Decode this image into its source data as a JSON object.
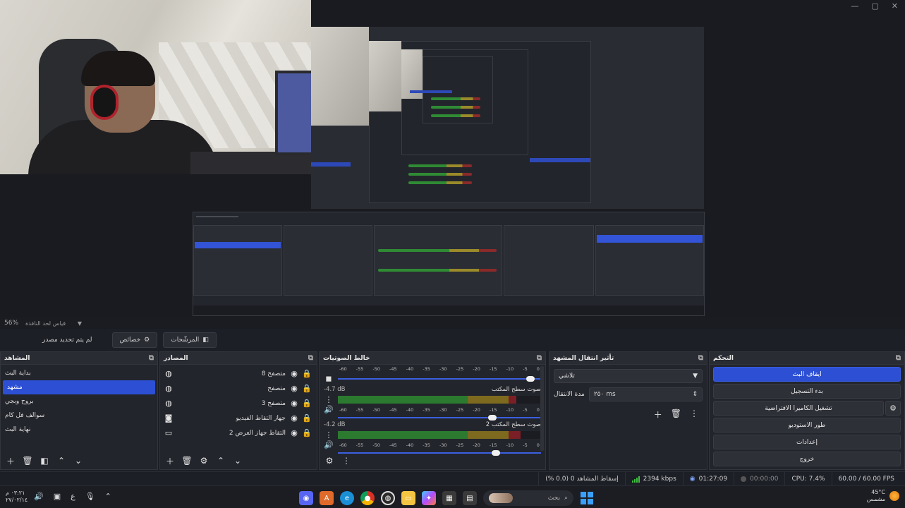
{
  "window": {
    "minimize": "—",
    "maximize": "▢",
    "close": "✕"
  },
  "zoom": {
    "percent": "56%",
    "label": "قياس لحد النافذة"
  },
  "toolbar": {
    "filters_label": "المرشّحات",
    "properties_label": "خصائص",
    "no_source_label": "لم يتم تحديد مصدر"
  },
  "scenes": {
    "title": "المشاهد",
    "items": [
      "بداية البث",
      "مشهد",
      "بروح وبجي",
      "سوالف فل كام",
      "نهاية البث"
    ],
    "active_index": 1
  },
  "sources": {
    "title": "المصادر",
    "items": [
      {
        "label": "متصفح 8",
        "icon": "globe-icon"
      },
      {
        "label": "متصفح",
        "icon": "globe-icon"
      },
      {
        "label": "متصفح 3",
        "icon": "globe-icon"
      },
      {
        "label": "جهاز التقاط الفيديو",
        "icon": "camera-icon"
      },
      {
        "label": "التقاط جهاز العرض 2",
        "icon": "monitor-icon"
      }
    ]
  },
  "mixer": {
    "title": "خالط الصوتيات",
    "ticks": [
      "-60",
      "-55",
      "-50",
      "-45",
      "-40",
      "-35",
      "-30",
      "-25",
      "-20",
      "-15",
      "-10",
      "-5",
      "0"
    ],
    "strips": [
      {
        "name": "",
        "db": "",
        "level": 0.0,
        "volume": 0.97
      },
      {
        "name": "صوت سطح المكتب",
        "db": "-4.7 dB",
        "level": 0.88,
        "volume": 0.78
      },
      {
        "name": "صوت سطح المكتب 2",
        "db": "-4.2 dB",
        "level": 0.9,
        "volume": 0.8
      }
    ]
  },
  "transitions": {
    "title": "تأثير انتقال المشهد",
    "type": "تلاشي",
    "duration_label": "مدة الانتقال",
    "duration_value": "٢٥٠ ms"
  },
  "controls": {
    "title": "التحكم",
    "stop_stream": "ايقاف البث",
    "start_recording": "بدء التسجيل",
    "virtual_camera": "تشغيل الكاميرا الافتراضية",
    "studio_mode": "طور الاستوديو",
    "settings": "إعدادات",
    "exit": "خروج"
  },
  "status": {
    "dropped": "إسقاط المشاهد 0 (0.0 %)",
    "bitrate": "2394 kbps",
    "stream_time": "01:27:09",
    "rec_time": "00:00:00",
    "cpu": "CPU: 7.4%",
    "fps": "60.00 / 60.00 FPS"
  },
  "taskbar": {
    "time": "٠٣:٢١ م",
    "date": "٢٧/٠٢/١٤",
    "lang": "ع",
    "search_placeholder": "بحث",
    "weather_temp": "45°C",
    "weather_desc": "مشمس"
  },
  "colors": {
    "accent": "#2c4fd4",
    "meter_green": "#2b7a2f",
    "meter_yellow": "#7d6a1f",
    "meter_red": "#7a1f26"
  }
}
